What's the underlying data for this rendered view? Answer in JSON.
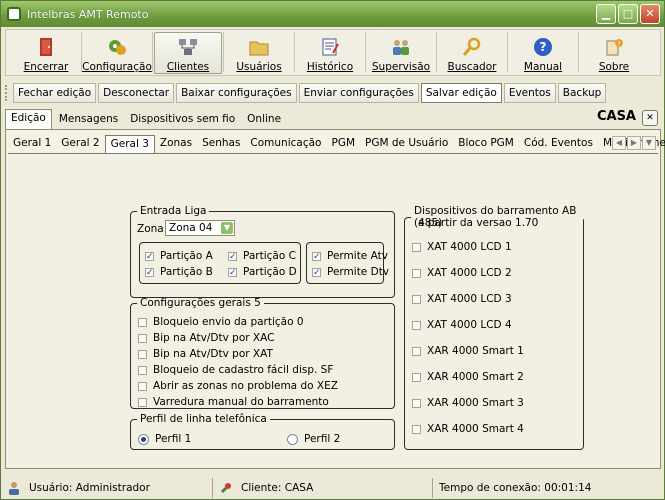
{
  "window": {
    "title": "Intelbras AMT Remoto"
  },
  "toolbar": {
    "buttons": [
      {
        "label": "Encerrar",
        "icon": "door-exit-icon"
      },
      {
        "label": "Configuração",
        "icon": "configuration-icon"
      },
      {
        "label": "Clientes",
        "icon": "clients-icon",
        "active": true
      },
      {
        "label": "Usuários",
        "icon": "folder-icon"
      },
      {
        "label": "Histórico",
        "icon": "history-notepad-icon"
      },
      {
        "label": "Supervisão",
        "icon": "supervision-people-icon"
      },
      {
        "label": "Buscador",
        "icon": "magnifier-icon"
      },
      {
        "label": "Manual",
        "icon": "help-icon"
      },
      {
        "label": "Sobre",
        "icon": "about-icon"
      }
    ]
  },
  "edit_toolbar": {
    "buttons": [
      "Fechar edição",
      "Desconectar",
      "Baixar configurações",
      "Enviar configurações",
      "Salvar edição",
      "Eventos",
      "Backup"
    ]
  },
  "outer_tabs": [
    "Edição",
    "Mensagens",
    "Dispositivos sem fio",
    "Online"
  ],
  "client_name": "CASA",
  "close_label": "✕",
  "inner_tabs": [
    "Geral 1",
    "Geral 2",
    "Geral 3",
    "Zonas",
    "Senhas",
    "Comunicação",
    "PGM",
    "PGM de Usuário",
    "Bloco PGM",
    "Cód. Eventos",
    "Monitoramento IP"
  ],
  "entrada_liga": {
    "title": "Entrada Liga",
    "zona_label": "Zona",
    "zona_value": "Zona 04",
    "particoes": [
      {
        "label": "Partição A",
        "checked": true
      },
      {
        "label": "Partição C",
        "checked": true
      },
      {
        "label": "Partição B",
        "checked": true
      },
      {
        "label": "Partição D",
        "checked": true
      }
    ],
    "permite": [
      {
        "label": "Permite Atv",
        "checked": true
      },
      {
        "label": "Permite Dtv",
        "checked": true
      }
    ]
  },
  "config_gerais": {
    "title": "Configurações gerais 5",
    "items": [
      "Bloqueio envio da partição 0",
      "Bip na Atv/Dtv por XAC",
      "Bip na Atv/Dtv por XAT",
      "Bloqueio de cadastro fácil disp. SF",
      "Abrir as zonas no problema do XEZ",
      "Varredura manual do barramento"
    ]
  },
  "perfil": {
    "title": "Perfil de linha telefônica",
    "options": [
      {
        "label": "Perfil 1",
        "selected": true
      },
      {
        "label": "Perfil 2",
        "selected": false
      }
    ]
  },
  "dispositivos": {
    "title_line1": "Dispositivos do barramento AB (485)",
    "title_line2": "a partir da versao 1.70",
    "items": [
      "XAT 4000 LCD 1",
      "XAT 4000 LCD 2",
      "XAT 4000 LCD 3",
      "XAT 4000 LCD 4",
      "XAR 4000 Smart 1",
      "XAR 4000 Smart 2",
      "XAR 4000 Smart 3",
      "XAR 4000 Smart 4"
    ]
  },
  "statusbar": {
    "user": "Usuário: Administrador",
    "client": "Cliente: CASA",
    "connection_time": "Tempo de conexão: 00:01:14"
  }
}
